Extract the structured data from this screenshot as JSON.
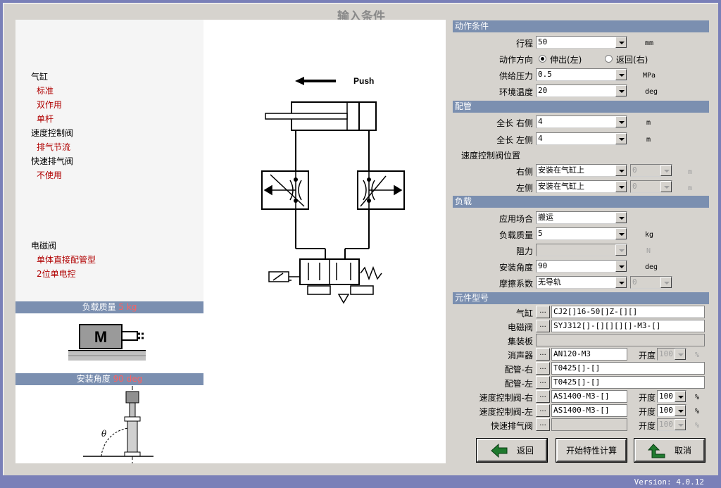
{
  "window": {
    "title": "输入条件",
    "version": "Version: 4.0.12"
  },
  "summary": {
    "cylinder": {
      "label": "气缸",
      "items": [
        "标准",
        "双作用",
        "单杆"
      ]
    },
    "speed_valve": {
      "label": "速度控制阀",
      "items": [
        "排气节流"
      ]
    },
    "quick_exhaust": {
      "label": "快速排气阀",
      "items": [
        "不使用"
      ]
    },
    "solenoid": {
      "label": "电磁阀",
      "items": [
        "单体直接配管型",
        "2位单电控"
      ]
    }
  },
  "diagram": {
    "push_label": "Push"
  },
  "load_bar": {
    "label": "负载质量",
    "value": "5 kg"
  },
  "angle_bar": {
    "label": "安装角度",
    "value": "90 deg"
  },
  "load_icon": "M",
  "angle_symbol": "θ",
  "sections": {
    "action": {
      "header": "动作条件",
      "stroke": {
        "label": "行程",
        "value": "50",
        "unit": "mm"
      },
      "direction": {
        "label": "动作方向",
        "opt1": "伸出(左)",
        "opt2": "返回(右)",
        "selected": "伸出(左)"
      },
      "pressure": {
        "label": "供给压力",
        "value": "0.5",
        "unit": "MPa"
      },
      "temperature": {
        "label": "环境温度",
        "value": "20",
        "unit": "deg"
      }
    },
    "piping": {
      "header": "配管",
      "len_right": {
        "label": "全长 右侧",
        "value": "4",
        "unit": "m"
      },
      "len_left": {
        "label": "全长 左侧",
        "value": "4",
        "unit": "m"
      },
      "valve_pos_label": "速度控制阀位置",
      "right": {
        "label": "右侧",
        "value": "安装在气缸上",
        "value2": "0",
        "unit": "m"
      },
      "left": {
        "label": "左侧",
        "value": "安装在气缸上",
        "value2": "0",
        "unit": "m"
      }
    },
    "load": {
      "header": "负载",
      "application": {
        "label": "应用场合",
        "value": "搬运"
      },
      "mass": {
        "label": "负载质量",
        "value": "5",
        "unit": "kg"
      },
      "resistance": {
        "label": "阻力",
        "value": "",
        "unit": "N"
      },
      "angle": {
        "label": "安装角度",
        "value": "90",
        "unit": "deg"
      },
      "friction": {
        "label": "摩擦系数",
        "value": "无导轨",
        "value2": "0"
      }
    },
    "parts": {
      "header": "元件型号",
      "cylinder": {
        "label": "气缸",
        "value": "CJ2[]16-50[]Z-[][]"
      },
      "solenoid": {
        "label": "电磁阀",
        "value": "SYJ312[]-[][][][]-M3-[]"
      },
      "manifold": {
        "label": "集装板",
        "value": ""
      },
      "silencer": {
        "label": "消声器",
        "value": "AN120-M3",
        "open_label": "开度",
        "open": "100",
        "pct": "%"
      },
      "pipe_right": {
        "label": "配管-右",
        "value": "T0425[]-[]"
      },
      "pipe_left": {
        "label": "配管-左",
        "value": "T0425[]-[]"
      },
      "sv_right": {
        "label": "速度控制阀-右",
        "value": "AS1400-M3-[]",
        "open_label": "开度",
        "open": "100",
        "pct": "%"
      },
      "sv_left": {
        "label": "速度控制阀-左",
        "value": "AS1400-M3-[]",
        "open_label": "开度",
        "open": "100",
        "pct": "%"
      },
      "quick_exhaust": {
        "label": "快速排气阀",
        "value": "",
        "open_label": "开度",
        "open": "100",
        "pct": "%"
      },
      "dots": "..."
    }
  },
  "buttons": {
    "back": "返回",
    "calc": "开始特性计算",
    "cancel": "取消"
  },
  "colors": {
    "section_bar": "#7b8fb0",
    "red_text": "#b00000",
    "window_bg": "#d6d3ce",
    "button_arrow": "#1f7a2e"
  }
}
